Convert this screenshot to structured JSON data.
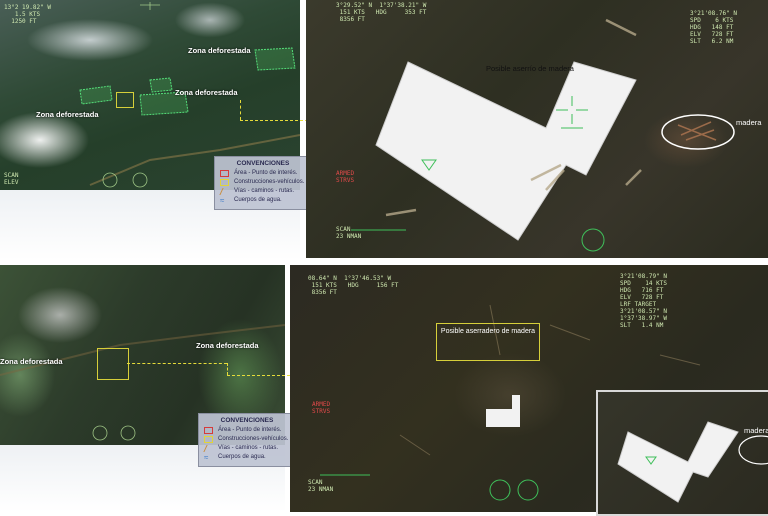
{
  "top_left": {
    "zone_labels": [
      "Zona deforestada",
      "Zona deforestada",
      "Zona deforestada"
    ],
    "hud_tl": "13°2 19.82\" W\n   1.5 KTS\n  1250 FT",
    "hud_br": "SCAN\nELEV"
  },
  "legend": {
    "title": "CONVENCIONES",
    "items": [
      {
        "label": "Área - Punto de interés.",
        "symbol": "red-box"
      },
      {
        "label": "Construcciones-vehículos.",
        "symbol": "yellow-box"
      },
      {
        "label": "Vías - caminos - rutas.",
        "symbol": "road"
      },
      {
        "label": "Cuerpos de agua.",
        "symbol": "water"
      }
    ]
  },
  "top_right": {
    "label_sawmill": "Posible aserrío de madera",
    "label_wood": "madera",
    "hud_left": "3°29.52\" N  1°37'38.21\" W\n 151 KTS   HDG     353 FT\n 8356 FT",
    "hud_right": "3°21'08.76\" N\nSPD    6 KTS\nHDG   148 FT\nELV   728 FT\nSLT   6.2 NM",
    "hud_red": "ARMED\nSTRVS",
    "hud_bottom": "SCAN\n23 NMAN"
  },
  "bottom_left": {
    "zone_labels": [
      "Zona deforestada",
      "Zona deforestada"
    ]
  },
  "bottom_right": {
    "label_sawmill": "Posible aserradero de madera",
    "label_wood": "madera",
    "hud_left": "08.64\" N  1°37'46.53\" W\n 151 KTS   HDG     156 FT\n 8356 FT",
    "hud_right": "3°21'08.79\" N\nSPD    14 KTS\nHDG   716 FT\nELV   728 FT\nLRF TARGET\n3°21'08.57\" N\n1°37'38.97\" W\nSLT   1.4 NM",
    "hud_red": "ARMED\nSTRVS",
    "hud_bottom": "SCAN\n23 NMAN"
  },
  "colors": {
    "annotation_yellow": "#e6dc3a",
    "poi_red": "#d63a3a",
    "road_orange": "#c98c3c",
    "water_blue": "#3a7ac9"
  }
}
